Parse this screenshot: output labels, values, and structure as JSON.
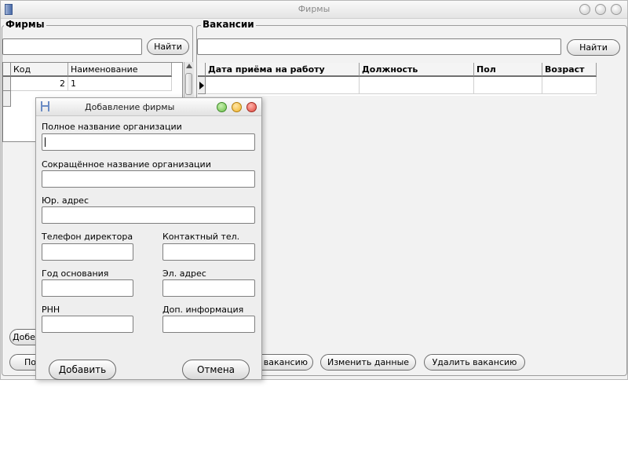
{
  "main_window": {
    "title": "Фирмы"
  },
  "firms": {
    "group_title": "Фирмы",
    "search_value": "",
    "search_button": "Найти",
    "columns": [
      "Код",
      "Наименование"
    ],
    "rows": [
      {
        "code": "2",
        "name": "1"
      }
    ],
    "add_button_partial": "Добе",
    "second_button_partial": "По"
  },
  "vacancies": {
    "group_title": "Вакансии",
    "search_value": "",
    "search_button": "Найти",
    "columns": [
      "Дата приёма на работу",
      "Должность",
      "Пол",
      "Возраст"
    ],
    "add_vacancy_partial": "вакансию",
    "edit_button": "Изменить данные",
    "delete_button": "Удалить вакансию"
  },
  "dialog": {
    "title": "Добавление фирмы",
    "labels": {
      "full_name": "Полное название организации",
      "short_name": "Сокращённое название организации",
      "legal_address": "Юр. адрес",
      "director_phone": "Телефон директора",
      "contact_phone": "Контактный тел.",
      "founded_year": "Год основания",
      "email": "Эл. адрес",
      "rnn": "РНН",
      "extra_info": "Доп. информация"
    },
    "add_button": "Добавить",
    "cancel_button": "Отмена",
    "colors": {
      "close": "#e0483e",
      "minimize": "#f0b429",
      "maximize": "#6cc04a"
    }
  }
}
